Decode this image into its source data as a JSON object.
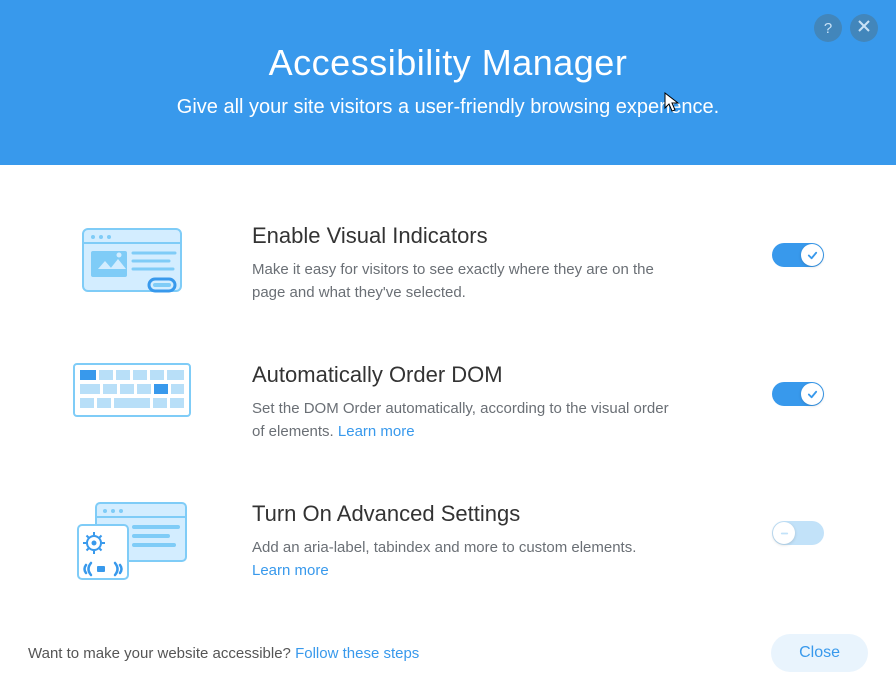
{
  "header": {
    "title": "Accessibility Manager",
    "subtitle": "Give all your site visitors a user-friendly browsing experience."
  },
  "options": [
    {
      "title": "Enable Visual Indicators",
      "desc": "Make it easy for visitors to see exactly where they are on the page and what they've selected.",
      "learn_more": null,
      "enabled": true
    },
    {
      "title": "Automatically Order DOM",
      "desc": "Set the DOM Order automatically, according to the visual order of elements. ",
      "learn_more": "Learn more",
      "enabled": true
    },
    {
      "title": "Turn On Advanced Settings",
      "desc": "Add an aria-label, tabindex and more to custom elements. ",
      "learn_more": "Learn more",
      "enabled": false
    }
  ],
  "footer": {
    "prompt": "Want to make your website accessible? ",
    "link": "Follow these steps",
    "close": "Close"
  }
}
